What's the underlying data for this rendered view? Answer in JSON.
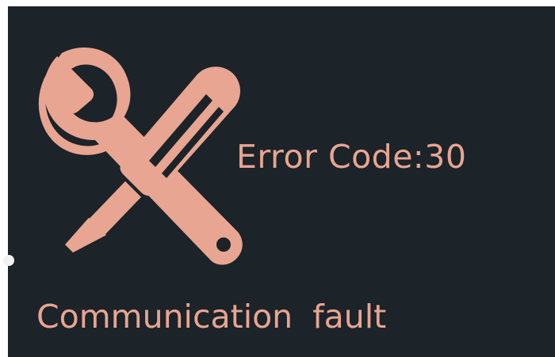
{
  "screen": {
    "error_code_text": "Error Code:30",
    "fault_text": "Communication  fault",
    "icon": "wrench-and-screwdriver-icon",
    "colors": {
      "background": "#1c2329",
      "accent": "#e8a591"
    }
  }
}
